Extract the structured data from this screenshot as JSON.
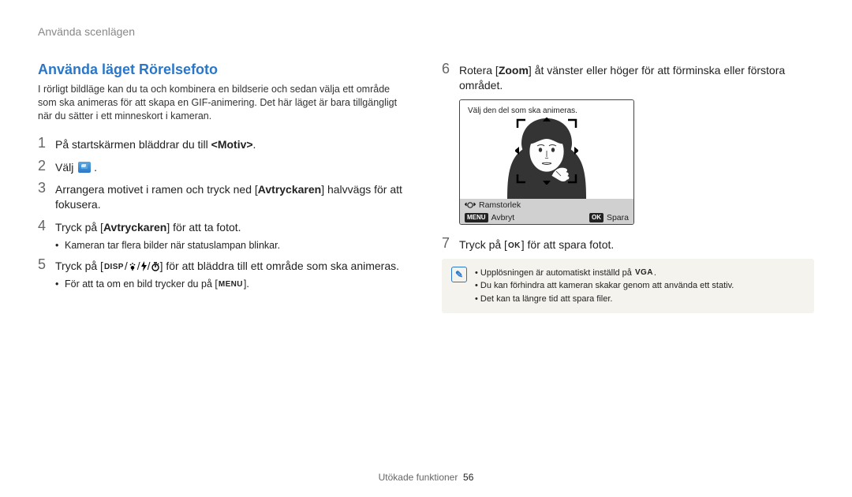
{
  "running_head": "Använda scenlägen",
  "section_title": "Använda läget Rörelsefoto",
  "intro": "I rörligt bildläge kan du ta och kombinera en bildserie och sedan välja ett område som ska animeras för att skapa en GIF-animering. Det här läget är bara tillgängligt när du sätter i ett minneskort i kameran.",
  "steps": {
    "s1": {
      "num": "1",
      "pre": "På startskärmen bläddrar du till ",
      "bold": "<Motiv>",
      "post": "."
    },
    "s2": {
      "num": "2",
      "pre": "Välj ",
      "icon_name": "motion-mode-icon",
      "post": " ."
    },
    "s3": {
      "num": "3",
      "text_a": "Arrangera motivet i ramen och tryck ned [",
      "bold": "Avtryckaren",
      "text_b": "] halvvägs för att fokusera."
    },
    "s3b": {
      "text": "Kameran tar flera bilder när statuslampan blinkar."
    },
    "s4": {
      "num": "4",
      "text_a": "Tryck på [",
      "bold": "Avtryckaren",
      "text_b": "] för att ta fotot."
    },
    "s5": {
      "num": "5",
      "text_a": "Tryck på [",
      "buttons": "DISP / flower / bolt / timer",
      "text_b": "] för att bläddra till ett område som ska animeras."
    },
    "s5b": {
      "text_a": "För att ta om en bild trycker du på [",
      "btn": "MENU",
      "text_b": "]."
    },
    "s6": {
      "num": "6",
      "text_a": "Rotera [",
      "bold": "Zoom",
      "text_b": "] åt vänster eller höger för att förminska eller förstora området."
    },
    "s7": {
      "num": "7",
      "text_a": "Tryck på [",
      "btn": "OK",
      "text_b": "] för att spara fotot."
    }
  },
  "shot": {
    "overlay": "Välj den del som ska animeras.",
    "control_zoom": "Ramstorlek",
    "control_menu_label": "MENU",
    "control_cancel": "Avbryt",
    "control_ok_label": "OK",
    "control_save": "Spara"
  },
  "info": {
    "items": [
      {
        "pre": "Upplösningen är automatiskt inställd på ",
        "badge": "VGA",
        "post": "."
      },
      {
        "pre": "Du kan förhindra att kameran skakar genom att använda ett stativ."
      },
      {
        "pre": "Det kan ta längre tid att spara filer."
      }
    ]
  },
  "footer": {
    "label": "Utökade funktioner",
    "page": "56"
  }
}
